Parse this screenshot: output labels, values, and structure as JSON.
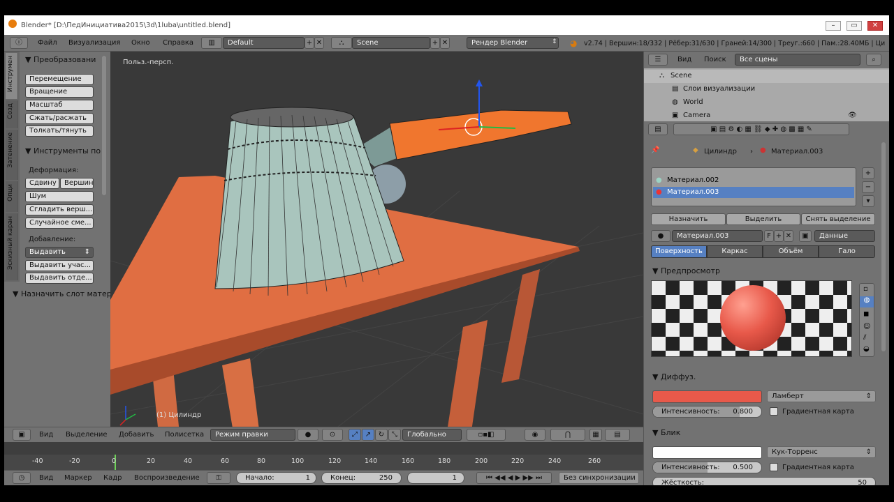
{
  "window": {
    "title": "Blender* [D:\\ПедИнициатива2015\\3d\\1luba\\untitled.blend]",
    "min_icon": "minimize-icon",
    "max_icon": "maximize-icon",
    "close_icon": "close-icon"
  },
  "info_header": {
    "menus": [
      "Файл",
      "Визуализация",
      "Окно",
      "Справка"
    ],
    "layout": "Default",
    "scene": "Scene",
    "engine": "Рендер Blender",
    "stats": "v2.74 | Вершин:18/332 | Рёбер:31/630 | Граней:14/300 | Треуг.:660 | Пам.:28.40МБ | Ци"
  },
  "toolshelf": {
    "tabs": [
      "Инструмен",
      "Созд",
      "Затенение",
      "Опци",
      "Эскизный каран"
    ],
    "transform_header": "Преобразовани",
    "transform_buttons": [
      "Перемещение",
      "Вращение",
      "Масштаб",
      "Сжать/раcжать",
      "Толкать/тянуть"
    ],
    "mesh_tools_header": "Инструменты по",
    "deform_label": "Деформация:",
    "deform_buttons_row": [
      "Сдвину",
      "Вершин"
    ],
    "deform_buttons": [
      "Шум",
      "Сгладить верш...",
      "Случайное сме..."
    ],
    "add_label": "Добавление:",
    "extrude_select": "Выдавить",
    "add_buttons": [
      "Выдавить учас...",
      "Выдавить отде..."
    ],
    "assign_slot_header": "Назначить слот матер"
  },
  "viewport": {
    "view_label": "Польз.-персп.",
    "object_label": "(1) Цилиндр"
  },
  "view3d_header": {
    "menus": [
      "Вид",
      "Выделение",
      "Добавить",
      "Полисетка"
    ],
    "mode": "Режим правки",
    "orientation": "Глобально"
  },
  "timeline": {
    "ticks": [
      "-40",
      "-20",
      "0",
      "20",
      "40",
      "60",
      "80",
      "100",
      "120",
      "140",
      "160",
      "180",
      "200",
      "220",
      "240",
      "260"
    ],
    "menus": [
      "Вид",
      "Маркер",
      "Кадр",
      "Воспроизведение"
    ],
    "start_label": "Начало:",
    "start_value": "1",
    "end_label": "Конец:",
    "end_value": "250",
    "current_frame": "1",
    "sync": "Без синхронизации"
  },
  "outliner": {
    "menus": [
      "Вид",
      "Поиск"
    ],
    "filter": "Все сцены",
    "rows": [
      "Scene",
      "Слои визуализации",
      "World",
      "Camera"
    ]
  },
  "properties": {
    "breadcrumb_object": "Цилиндр",
    "breadcrumb_material": "Материал.003",
    "materials": [
      "Материал.002",
      "Материал.003"
    ],
    "buttons": [
      "Назначить",
      "Выделить",
      "Снять выделение"
    ],
    "material_name": "Материал.003",
    "fake_user": "F",
    "data_select": "Данные",
    "tabs": [
      "Поверхность",
      "Каркас",
      "Объём",
      "Гало"
    ],
    "preview_header": "Предпросмотр",
    "diffuse_header": "Диффуз.",
    "diffuse_shader": "Ламберт",
    "diffuse_intensity_label": "Интенсивность:",
    "diffuse_intensity": "0.800",
    "diffuse_ramp": "Градиентная карта",
    "specular_header": "Блик",
    "specular_shader": "Кук-Торренс",
    "specular_intensity_label": "Интенсивность:",
    "specular_intensity": "0.500",
    "specular_ramp": "Градиентная карта",
    "hardness_label": "Жёсткость:",
    "hardness_value": "50",
    "diffuse_color": "#e8594a",
    "specular_color": "#ffffff"
  }
}
